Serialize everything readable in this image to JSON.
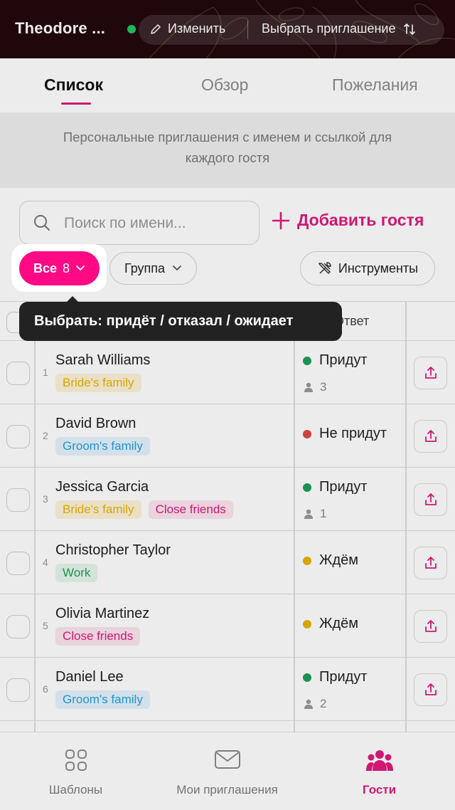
{
  "header": {
    "title": "Theodore ...",
    "edit_label": "Изменить",
    "select_invitation_label": "Выбрать приглашение"
  },
  "tabs": [
    {
      "label": "Список",
      "active": true
    },
    {
      "label": "Обзор",
      "active": false
    },
    {
      "label": "Пожелания",
      "active": false
    }
  ],
  "banner": {
    "line1": "Персональные приглашения с именем и ссылкой для",
    "line2": "каждого гостя"
  },
  "search": {
    "placeholder": "Поиск по имени...",
    "value": ""
  },
  "add_guest_label": "Добавить гостя",
  "filters": {
    "all_label": "Все",
    "all_count": "8",
    "group_label": "Группа",
    "tools_label": "Инструменты"
  },
  "table": {
    "answer_header": "Ответ",
    "rows": [
      {
        "num": "1",
        "name": "Sarah Williams",
        "tags": [
          {
            "label": "Bride's family",
            "kind": "bride"
          }
        ],
        "status": "Придут",
        "status_kind": "yes",
        "count": "3"
      },
      {
        "num": "2",
        "name": "David Brown",
        "tags": [
          {
            "label": "Groom's family",
            "kind": "groom"
          }
        ],
        "status": "Не придут",
        "status_kind": "no",
        "count": ""
      },
      {
        "num": "3",
        "name": "Jessica Garcia",
        "tags": [
          {
            "label": "Bride's family",
            "kind": "bride"
          },
          {
            "label": "Close friends",
            "kind": "close"
          }
        ],
        "status": "Придут",
        "status_kind": "yes",
        "count": "1"
      },
      {
        "num": "4",
        "name": "Christopher Taylor",
        "tags": [
          {
            "label": "Work",
            "kind": "work"
          }
        ],
        "status": "Ждём",
        "status_kind": "wait",
        "count": ""
      },
      {
        "num": "5",
        "name": "Olivia Martinez",
        "tags": [
          {
            "label": "Close friends",
            "kind": "close"
          }
        ],
        "status": "Ждём",
        "status_kind": "wait",
        "count": ""
      },
      {
        "num": "6",
        "name": "Daniel Lee",
        "tags": [
          {
            "label": "Groom's family",
            "kind": "groom"
          }
        ],
        "status": "Придут",
        "status_kind": "yes",
        "count": "2"
      }
    ]
  },
  "tooltip": {
    "text": "Выбрать: придёт / отказал / ожидает"
  },
  "bottom_nav": [
    {
      "label": "Шаблоны",
      "icon": "grid-icon",
      "active": false
    },
    {
      "label": "Мои приглашения",
      "icon": "mail-icon",
      "active": false
    },
    {
      "label": "Гости",
      "icon": "people-icon",
      "active": true
    }
  ],
  "colors": {
    "accent": "#e0197d",
    "filter_active": "#ff0a84",
    "status_yes": "#1e9e5a",
    "status_no": "#e04848",
    "status_wait": "#e8b400",
    "header_bg": "#22080e"
  }
}
